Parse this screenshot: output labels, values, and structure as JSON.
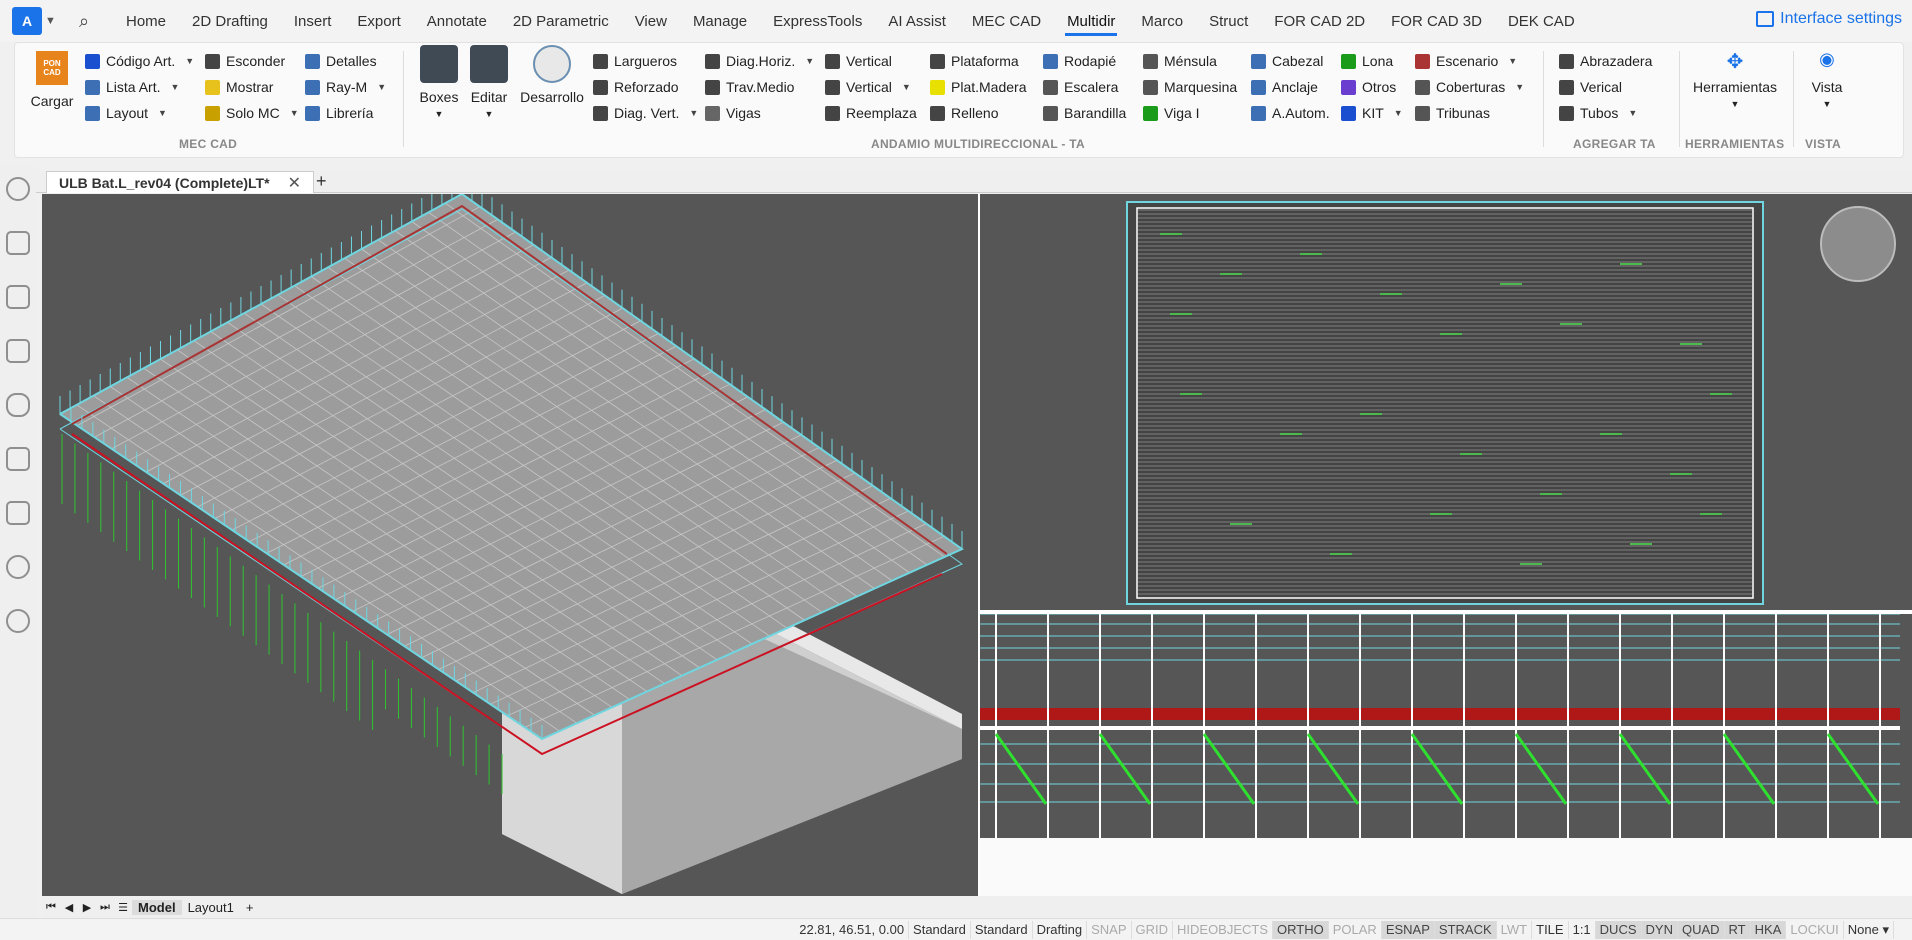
{
  "menubar": {
    "tabs": [
      "Home",
      "2D Drafting",
      "Insert",
      "Export",
      "Annotate",
      "2D Parametric",
      "View",
      "Manage",
      "ExpressTools",
      "AI Assist",
      "MEC CAD",
      "Multidir",
      "Marco",
      "Struct",
      "FOR CAD 2D",
      "FOR CAD 3D",
      "DEK CAD"
    ],
    "active_tab": "Multidir",
    "interface_settings": "Interface settings"
  },
  "ribbon": {
    "cargar": "Cargar",
    "logo_text": "PON CAD",
    "mec_col1": [
      "Código Art.",
      "Lista Art.",
      "Layout"
    ],
    "mec_col2": [
      "Esconder",
      "Mostrar",
      "Solo MC"
    ],
    "mec_col3": [
      "Detalles",
      "Ray-M",
      "Librería"
    ],
    "boxes": "Boxes",
    "editar": "Editar",
    "desarrollo": "Desarrollo",
    "and_col1": [
      "Largueros",
      "Reforzado",
      "Diag. Vert."
    ],
    "and_col2": [
      "Diag.Horiz.",
      "Trav.Medio",
      "Vigas"
    ],
    "and_col3": [
      "Vertical",
      "Vertical",
      "Reemplaza"
    ],
    "and_col4": [
      "Plataforma",
      "Plat.Madera",
      "Relleno"
    ],
    "and_col5": [
      "Rodapié",
      "Escalera",
      "Barandilla"
    ],
    "and_col6": [
      "Ménsula",
      "Marquesina",
      "Viga I"
    ],
    "and_col7": [
      "Cabezal",
      "Anclaje",
      "A.Autom."
    ],
    "and_col8": [
      "Lona",
      "Otros",
      "KIT"
    ],
    "and_col9": [
      "Escenario",
      "Coberturas",
      "Tribunas"
    ],
    "agr_col": [
      "Abrazadera",
      "Verical",
      "Tubos"
    ],
    "herramientas": "Herramientas",
    "vista": "Vista",
    "groups": {
      "mec": "MEC CAD",
      "andamio": "ANDAMIO MULTIDIRECCIONAL - TA",
      "agregar": "AGREGAR TA",
      "herr": "HERRAMIENTAS",
      "vista": "VISTA"
    }
  },
  "document": {
    "tab": "ULB Bat.L_rev04 (Complete)LT*"
  },
  "layouts": {
    "tabs": [
      "Model",
      "Layout1"
    ],
    "active": "Model"
  },
  "status": {
    "coords": "22.81, 46.51, 0.00",
    "items": [
      "Standard",
      "Standard",
      "Drafting",
      "SNAP",
      "GRID",
      "HIDEOBJECTS",
      "ORTHO",
      "POLAR",
      "ESNAP",
      "STRACK",
      "LWT",
      "TILE",
      "1:1",
      "DUCS",
      "DYN",
      "QUAD",
      "RT",
      "HKA",
      "LOCKUI",
      "None"
    ],
    "on": [
      "ORTHO",
      "ESNAP",
      "STRACK",
      "DUCS",
      "DYN",
      "QUAD",
      "RT",
      "HKA"
    ],
    "off": [
      "SNAP",
      "GRID",
      "HIDEOBJECTS",
      "POLAR",
      "LWT",
      "LOCKUI"
    ]
  }
}
